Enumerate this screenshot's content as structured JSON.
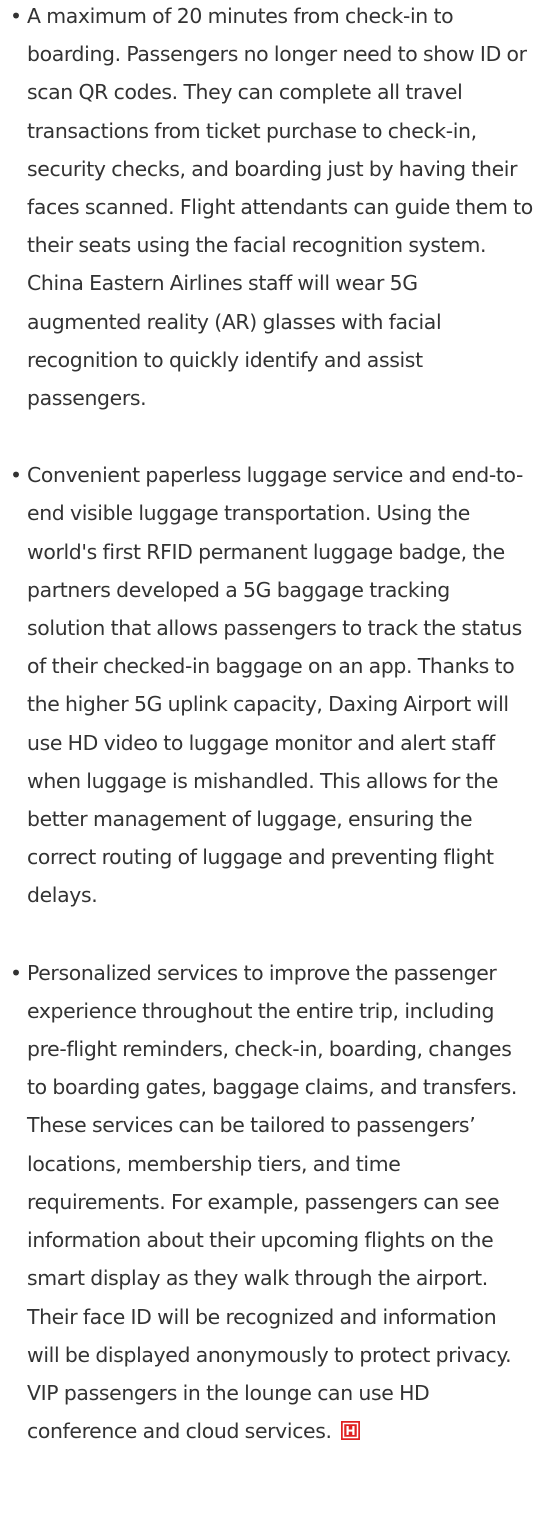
{
  "bullet_char": "•",
  "paragraphs": [
    {
      "text": "A maximum of 20 minutes from check-in to boarding. Passengers no longer need to show ID or scan QR codes. They can complete all travel transactions from ticket purchase to check-in, security checks, and boarding just by having their faces scanned. Flight attendants can guide them to their seats using the facial recognition system. China Eastern Airlines staff will wear 5G augmented reality (AR) glasses with facial recognition to quickly identify and assist passengers."
    },
    {
      "text": "Convenient paperless luggage service and end-to-end visible luggage transportation. Using the world's first RFID permanent luggage badge, the partners developed a 5G baggage tracking solution that allows passengers to track the status of their checked-in baggage on an app. Thanks to the higher 5G uplink capacity, Daxing Airport will use HD video to luggage monitor and alert staff when luggage is mishandled. This allows for the better management of luggage, ensuring the correct routing of luggage and preventing flight delays."
    },
    {
      "text": "Personalized services to improve the passenger experience throughout the entire trip, including pre-flight reminders, check-in, boarding, changes to boarding gates, baggage claims, and transfers. These services can be tailored to passengers’ locations, membership tiers, and time requirements. For example, passengers can see information about their upcoming flights on the smart display as they walk through the airport. Their face ID will be recognized and information will be displayed anonymously to protect privacy. VIP passengers in the lounge can use HD conference and cloud services."
    }
  ],
  "end_mark": {
    "icon": "end-of-article-icon",
    "color": "#e02020"
  }
}
